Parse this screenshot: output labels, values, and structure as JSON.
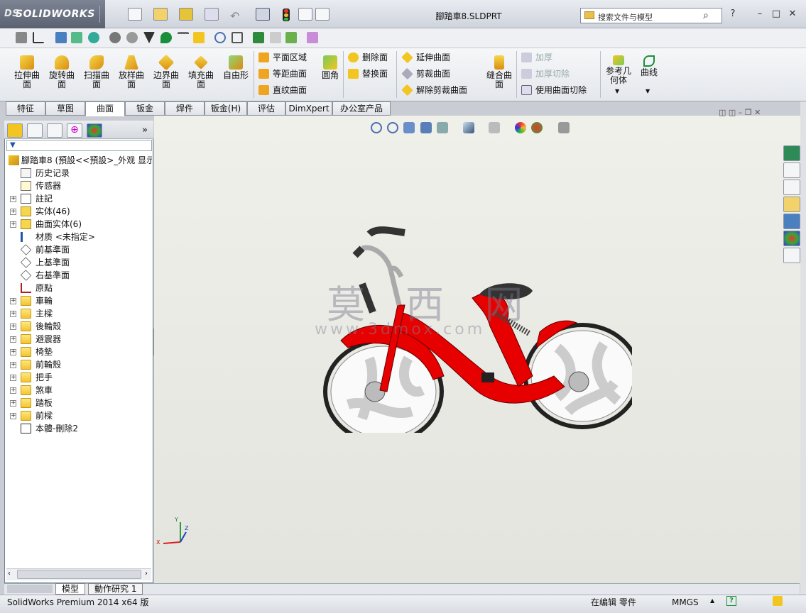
{
  "app": {
    "brand": "SOLIDWORKS",
    "brand_prefix": "DS",
    "doc_title": "腳踏車8.SLDPRT"
  },
  "search": {
    "placeholder": "搜索文件与模型"
  },
  "window_controls": {
    "help": "?",
    "minimize": "–",
    "restore": "□",
    "close": "✕"
  },
  "ribbon": {
    "big_buttons": [
      {
        "label": "拉伸曲面",
        "icon": "extruded-surface-icon"
      },
      {
        "label": "旋转曲面",
        "icon": "revolved-surface-icon"
      },
      {
        "label": "扫描曲面",
        "icon": "swept-surface-icon"
      },
      {
        "label": "放样曲面",
        "icon": "lofted-surface-icon"
      },
      {
        "label": "边界曲面",
        "icon": "boundary-surface-icon"
      },
      {
        "label": "填充曲面",
        "icon": "filled-surface-icon"
      },
      {
        "label": "自由形",
        "icon": "freeform-icon"
      }
    ],
    "col1": [
      "平面区域",
      "等距曲面",
      "直纹曲面"
    ],
    "fillet": "圆角",
    "col2": [
      "删除面",
      "替换面"
    ],
    "col3": [
      "延伸曲面",
      "剪裁曲面",
      "解除剪裁曲面"
    ],
    "knit": "缝合曲面",
    "col4": [
      "加厚",
      "加厚切除",
      "使用曲面切除"
    ],
    "refgeom": "参考几何体",
    "curves": "曲线"
  },
  "tabs": [
    "特征",
    "草图",
    "曲面",
    "钣金",
    "焊件",
    "钣金(H)",
    "评估",
    "DimXpert",
    "办公室产品"
  ],
  "active_tab": "曲面",
  "panel": {
    "expand": "»"
  },
  "tree": [
    {
      "label": "腳踏車8 (預設<<預設>_外观 显示",
      "icon": "part-icon",
      "expand": false
    },
    {
      "label": "历史记录",
      "icon": "history-icon",
      "expand": false
    },
    {
      "label": "传感器",
      "icon": "sensor-icon",
      "expand": false
    },
    {
      "label": "註記",
      "icon": "annotation-icon",
      "expand": true
    },
    {
      "label": "实体(46)",
      "icon": "solid-bodies-icon",
      "expand": true
    },
    {
      "label": "曲面实体(6)",
      "icon": "surface-bodies-icon",
      "expand": true
    },
    {
      "label": "材质 <未指定>",
      "icon": "material-icon",
      "expand": false
    },
    {
      "label": "前基準面",
      "icon": "plane-icon",
      "expand": false
    },
    {
      "label": "上基準面",
      "icon": "plane-icon",
      "expand": false
    },
    {
      "label": "右基準面",
      "icon": "plane-icon",
      "expand": false
    },
    {
      "label": "原點",
      "icon": "origin-icon",
      "expand": false
    },
    {
      "label": "車輪",
      "icon": "folder-icon",
      "expand": true
    },
    {
      "label": "主樑",
      "icon": "folder-icon",
      "expand": true
    },
    {
      "label": "後輪殼",
      "icon": "folder-icon",
      "expand": true
    },
    {
      "label": "避震器",
      "icon": "folder-icon",
      "expand": true
    },
    {
      "label": "椅墊",
      "icon": "folder-icon",
      "expand": true
    },
    {
      "label": "前輪殼",
      "icon": "folder-icon",
      "expand": true
    },
    {
      "label": "把手",
      "icon": "folder-icon",
      "expand": true
    },
    {
      "label": "煞車",
      "icon": "folder-icon",
      "expand": true
    },
    {
      "label": "踏板",
      "icon": "folder-icon",
      "expand": true
    },
    {
      "label": "前樑",
      "icon": "folder-icon",
      "expand": true
    },
    {
      "label": "本體-刪除2",
      "icon": "delete-body-icon",
      "expand": false
    }
  ],
  "bottom_tabs": [
    "模型",
    "動作研究 1"
  ],
  "status": {
    "left": "SolidWorks Premium 2014 x64 版",
    "mode": "在编辑 零件",
    "units": "MMGS",
    "units_arrow": "▲",
    "help": "?"
  },
  "watermark": {
    "main": "莫 西 网",
    "url": "www.3dmox.com"
  },
  "triad": {
    "y": "Y",
    "x": "X",
    "z": "Z"
  },
  "colors": {
    "bike_red": "#e60000",
    "tab_active": "#ffffff",
    "viewport_bg": "#ebebe5"
  }
}
